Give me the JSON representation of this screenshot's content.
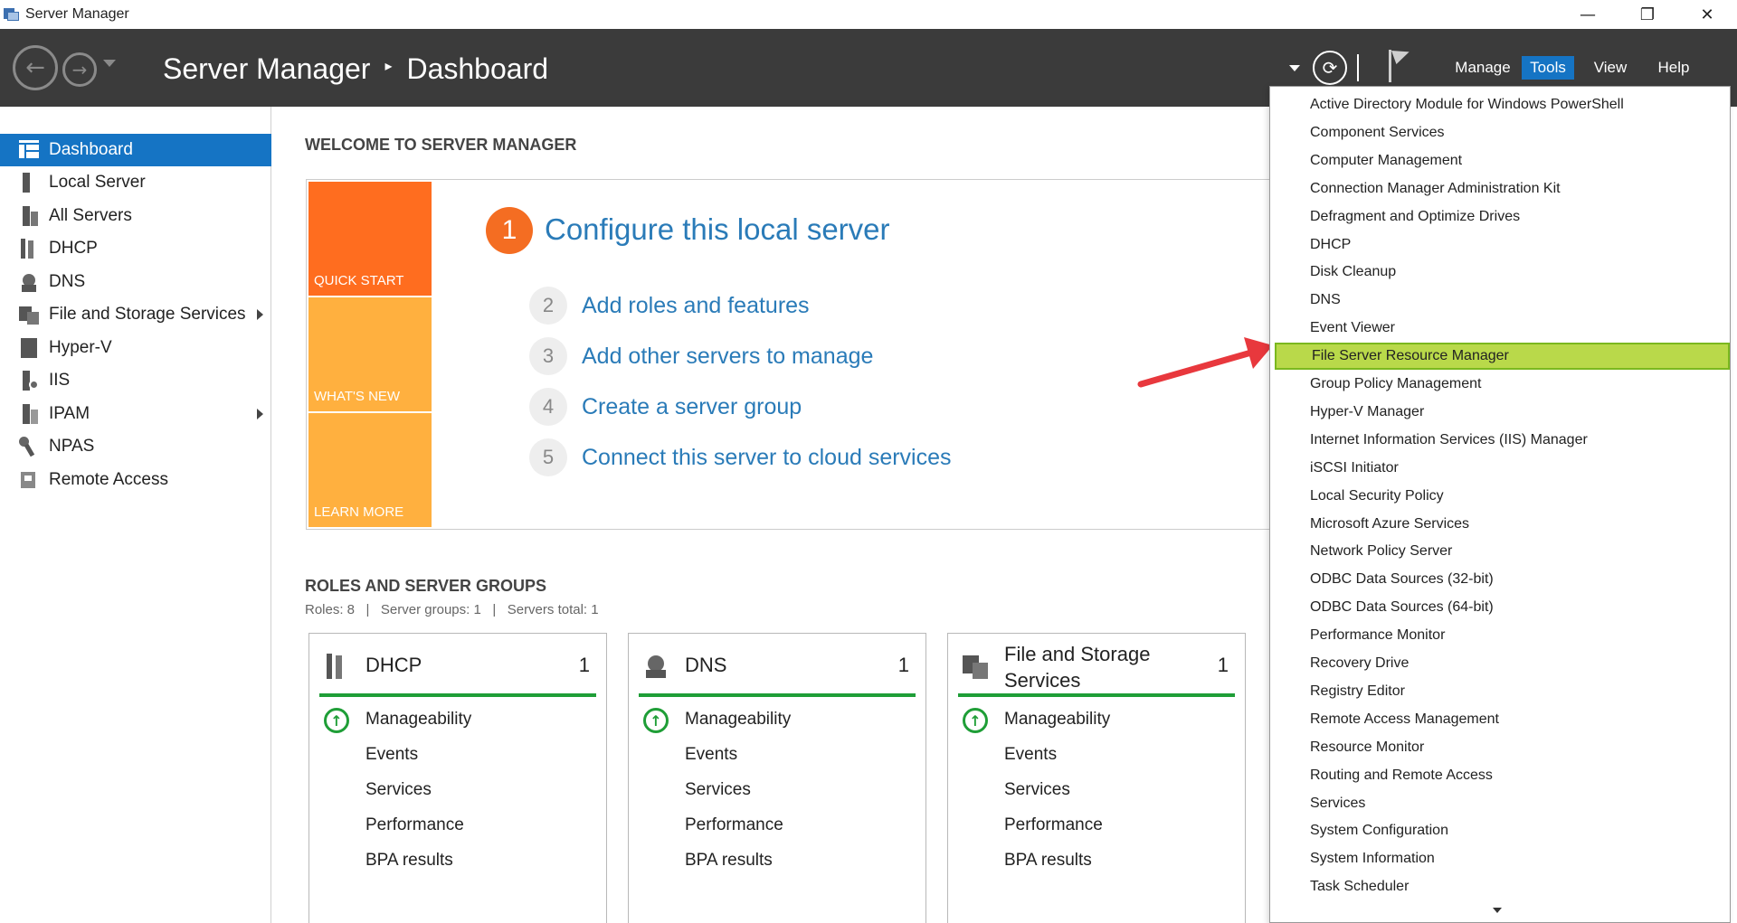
{
  "window": {
    "title": "Server Manager",
    "controls": [
      "—",
      "❐",
      "✕"
    ]
  },
  "header": {
    "breadcrumb_app": "Server Manager",
    "breadcrumb_separator": "▸",
    "breadcrumb_page": "Dashboard",
    "refresh_glyph": "⟳",
    "menus": {
      "manage": "Manage",
      "tools": "Tools",
      "view": "View",
      "help": "Help"
    },
    "header_bg": "#3b3b3b",
    "accent": "#1574c4"
  },
  "sidebar": {
    "items": [
      {
        "label": "Dashboard",
        "icon": "dashboard-icon",
        "active": true,
        "expandable": false
      },
      {
        "label": "Local Server",
        "icon": "local-server-icon",
        "active": false,
        "expandable": false
      },
      {
        "label": "All Servers",
        "icon": "all-servers-icon",
        "active": false,
        "expandable": false
      },
      {
        "label": "DHCP",
        "icon": "dhcp-icon",
        "active": false,
        "expandable": false
      },
      {
        "label": "DNS",
        "icon": "dns-icon",
        "active": false,
        "expandable": false
      },
      {
        "label": "File and Storage Services",
        "icon": "file-storage-icon",
        "active": false,
        "expandable": true
      },
      {
        "label": "Hyper-V",
        "icon": "hyper-v-icon",
        "active": false,
        "expandable": false
      },
      {
        "label": "IIS",
        "icon": "iis-icon",
        "active": false,
        "expandable": false
      },
      {
        "label": "IPAM",
        "icon": "ipam-icon",
        "active": false,
        "expandable": true
      },
      {
        "label": "NPAS",
        "icon": "npas-icon",
        "active": false,
        "expandable": false
      },
      {
        "label": "Remote Access",
        "icon": "remote-access-icon",
        "active": false,
        "expandable": false
      }
    ]
  },
  "welcome": {
    "title": "WELCOME TO SERVER MANAGER",
    "tiles": {
      "quick_start": "QUICK START",
      "whats_new": "WHAT'S NEW",
      "learn_more": "LEARN MORE"
    },
    "step1": {
      "num": "1",
      "label": "Configure this local server"
    },
    "steps": [
      {
        "num": "2",
        "label": "Add roles and features"
      },
      {
        "num": "3",
        "label": "Add other servers to manage"
      },
      {
        "num": "4",
        "label": "Create a server group"
      },
      {
        "num": "5",
        "label": "Connect this server to cloud services"
      }
    ]
  },
  "roles": {
    "title": "ROLES AND SERVER GROUPS",
    "summary": "Roles: 8   |   Server groups: 1   |   Servers total: 1",
    "cards": [
      {
        "name": "DHCP",
        "count": "1",
        "rows": [
          "Manageability",
          "Events",
          "Services",
          "Performance",
          "BPA results"
        ]
      },
      {
        "name": "DNS",
        "count": "1",
        "rows": [
          "Manageability",
          "Events",
          "Services",
          "Performance",
          "BPA results"
        ]
      },
      {
        "name": "File and Storage Services",
        "count": "1",
        "rows": [
          "Manageability",
          "Events",
          "Services",
          "Performance",
          "BPA results"
        ]
      }
    ]
  },
  "tools_menu": {
    "highlighted": "File Server Resource Manager",
    "items": [
      "Active Directory Module for Windows PowerShell",
      "Component Services",
      "Computer Management",
      "Connection Manager Administration Kit",
      "Defragment and Optimize Drives",
      "DHCP",
      "Disk Cleanup",
      "DNS",
      "Event Viewer",
      "File Server Resource Manager",
      "Group Policy Management",
      "Hyper-V Manager",
      "Internet Information Services (IIS) Manager",
      "iSCSI Initiator",
      "Local Security Policy",
      "Microsoft Azure Services",
      "Network Policy Server",
      "ODBC Data Sources (32-bit)",
      "ODBC Data Sources (64-bit)",
      "Performance Monitor",
      "Recovery Drive",
      "Registry Editor",
      "Remote Access Management",
      "Resource Monitor",
      "Routing and Remote Access",
      "Services",
      "System Configuration",
      "System Information",
      "Task Scheduler"
    ],
    "highlight_color": "#b9d94a"
  },
  "annotation": {
    "arrow_color": "#e8383d"
  }
}
